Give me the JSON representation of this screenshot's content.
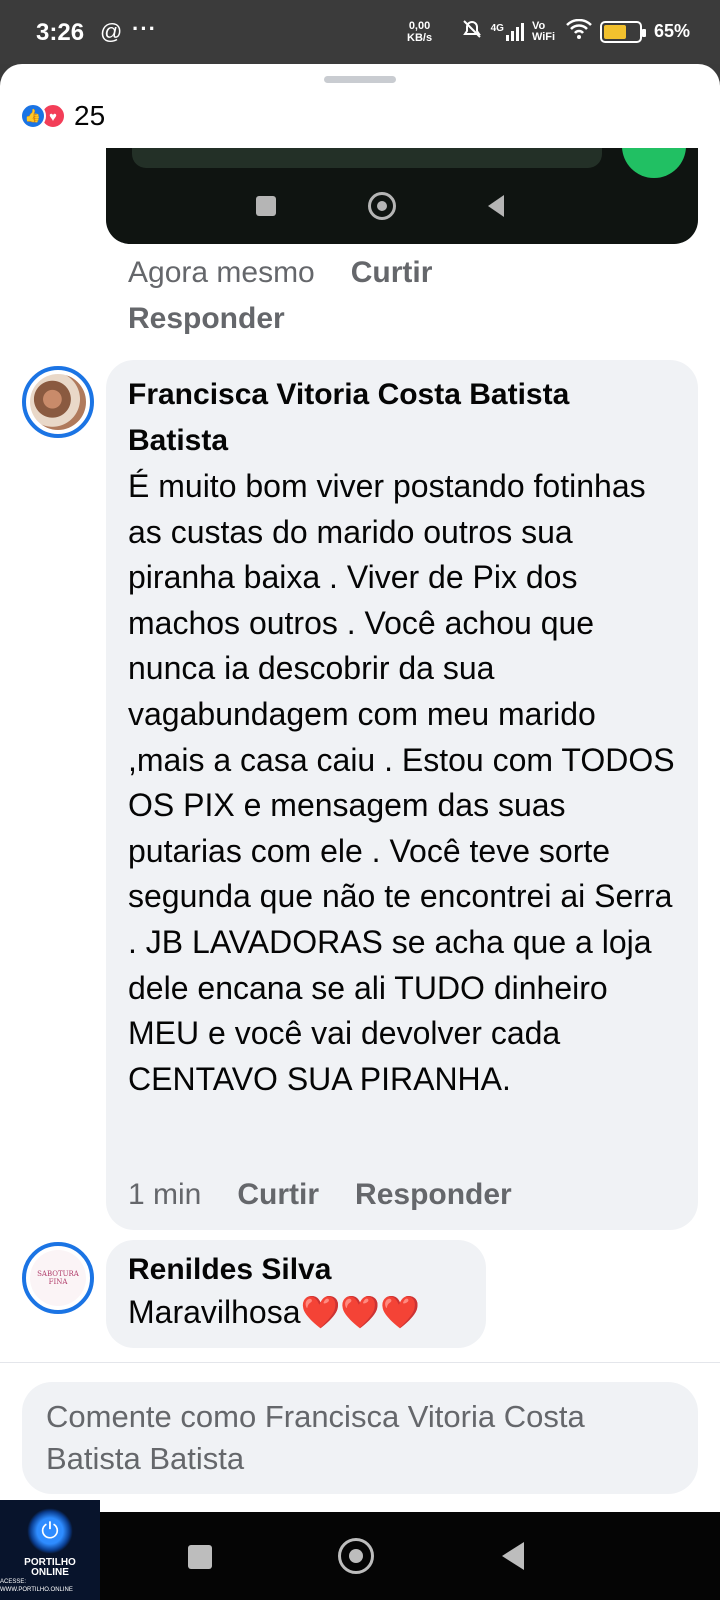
{
  "status_bar": {
    "time": "3:26",
    "threads_icon": "@",
    "more": "···",
    "net_speed_value": "0,00",
    "net_speed_unit": "KB/s",
    "signal_label": "4G",
    "vowifi_label": "Vo WiFi",
    "battery_percent": "65%",
    "battery_level": 0.65
  },
  "reactions": {
    "count": "25",
    "icons": [
      "like-icon",
      "love-icon"
    ]
  },
  "comments": [
    {
      "timestamp": "Agora mesmo",
      "like_label": "Curtir",
      "reply_label": "Responder"
    },
    {
      "author": "Francisca Vitoria Costa Batista Batista",
      "text": "É muito bom viver postando fotinhas as custas do marido outros sua piranha baixa . Viver de Pix dos machos outros . Você achou que nunca ia descobrir da sua vagabundagem com meu marido ,mais a casa caiu . Estou com TODOS OS PIX e mensagem das suas putarias com ele . Você teve sorte segunda que não te encontrei ai Serra . JB LAVADORAS se acha que a loja dele encana se ali TUDO dinheiro MEU e você vai devolver cada CENTAVO SUA PIRANHA.",
      "timestamp": "1 min",
      "like_label": "Curtir",
      "reply_label": "Responder"
    },
    {
      "author": "Renildes Silva",
      "text": "Maravilhosa❤️❤️❤️",
      "avatar_text_1": "SABOTURA",
      "avatar_text_2": "FINA"
    }
  ],
  "composer": {
    "placeholder": "Comente como Francisca Vitoria Costa Batista Batista"
  },
  "watermark": {
    "line1": "PORTILHO",
    "line2": "ONLINE",
    "line3": "ACESSE: WWW.PORTILHO.ONLINE"
  }
}
